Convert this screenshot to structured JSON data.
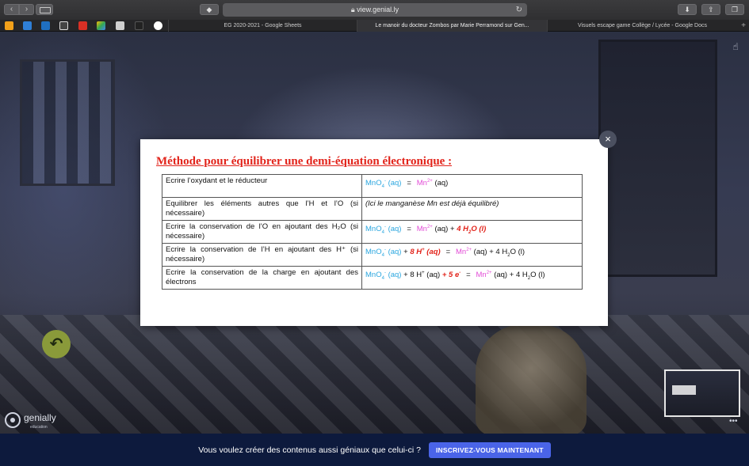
{
  "browser": {
    "url": "view.genial.ly",
    "url_lock_icon": "lock-icon",
    "tabs": [
      {
        "label": "EG 2020-2021 - Google Sheets",
        "active": false
      },
      {
        "label": "Le manoir du docteur Zombos par Marie Perramond sur Gen...",
        "active": true
      },
      {
        "label": "Visuels escape game Collège / Lycée - Google Docs",
        "active": false
      }
    ],
    "new_tab_label": "+",
    "bookmarks": [
      {
        "icon": "bookmark-orange-icon",
        "color": "#f2a11a"
      },
      {
        "icon": "bookmark-blue-icon",
        "color": "#2f7fd6"
      },
      {
        "icon": "outlook-icon",
        "color": "#1f6fc1"
      },
      {
        "icon": "pronote-icon",
        "color": "#ffffff"
      },
      {
        "icon": "gmail-icon",
        "color": "#d93025"
      },
      {
        "icon": "drive-icon",
        "color": "#fbbc04"
      },
      {
        "icon": "bookmark-gray-icon",
        "color": "#cfcfcf"
      },
      {
        "icon": "bookmark-dark-icon",
        "color": "#222222"
      },
      {
        "icon": "google-icon",
        "color": "#4285f4"
      }
    ]
  },
  "modal": {
    "title": "Méthode pour équilibrer une demi-équation électronique :",
    "close_label": "×",
    "rows": [
      {
        "desc": "Ecrire l’oxydant et le réducteur"
      },
      {
        "desc": "Equilibrer les éléments autres que l’H et l’O (si nécessaire)",
        "note": "(Ici le manganèse Mn est déjà équilibré)"
      },
      {
        "desc": "Ecrire la conservation de l’O en ajoutant des H₂O (si nécessaire)"
      },
      {
        "desc": "Ecrire la conservation de l’H en ajoutant des H⁺ (si nécessaire)"
      },
      {
        "desc": "Ecrire la conservation de la charge en ajoutant des électrons"
      }
    ],
    "chem": {
      "mno4": "MnO",
      "mno4_sub": "4",
      "mno4_sup": "-",
      "aq": "(aq)",
      "mn": "Mn",
      "mn_sup": "2+",
      "equals": "=",
      "plus": "+",
      "h2o_4": "4 H",
      "h2o_sub": "2",
      "h2o_o": "O",
      "h2o_liquid": "(l)",
      "h_plus_8": "8 H",
      "h_plus_sup": "+",
      "electrons": "+ 5 e",
      "electron_sup": "-"
    }
  },
  "back_button": {
    "icon": "undo-arrow-icon",
    "glyph": "↶"
  },
  "logo": {
    "name": "genially",
    "sub": "education"
  },
  "footer": {
    "text": "Vous voulez créer des contenus aussi géniaux que celui-ci ?",
    "button_label": "INSCRIVEZ-VOUS MAINTENANT"
  },
  "colors": {
    "title_red": "#e2231a",
    "oxidant_blue": "#2aa6df",
    "reducer_pink": "#e24bd6",
    "footer_bg": "#0d1a3d",
    "cta_blue": "#4a64e8"
  }
}
